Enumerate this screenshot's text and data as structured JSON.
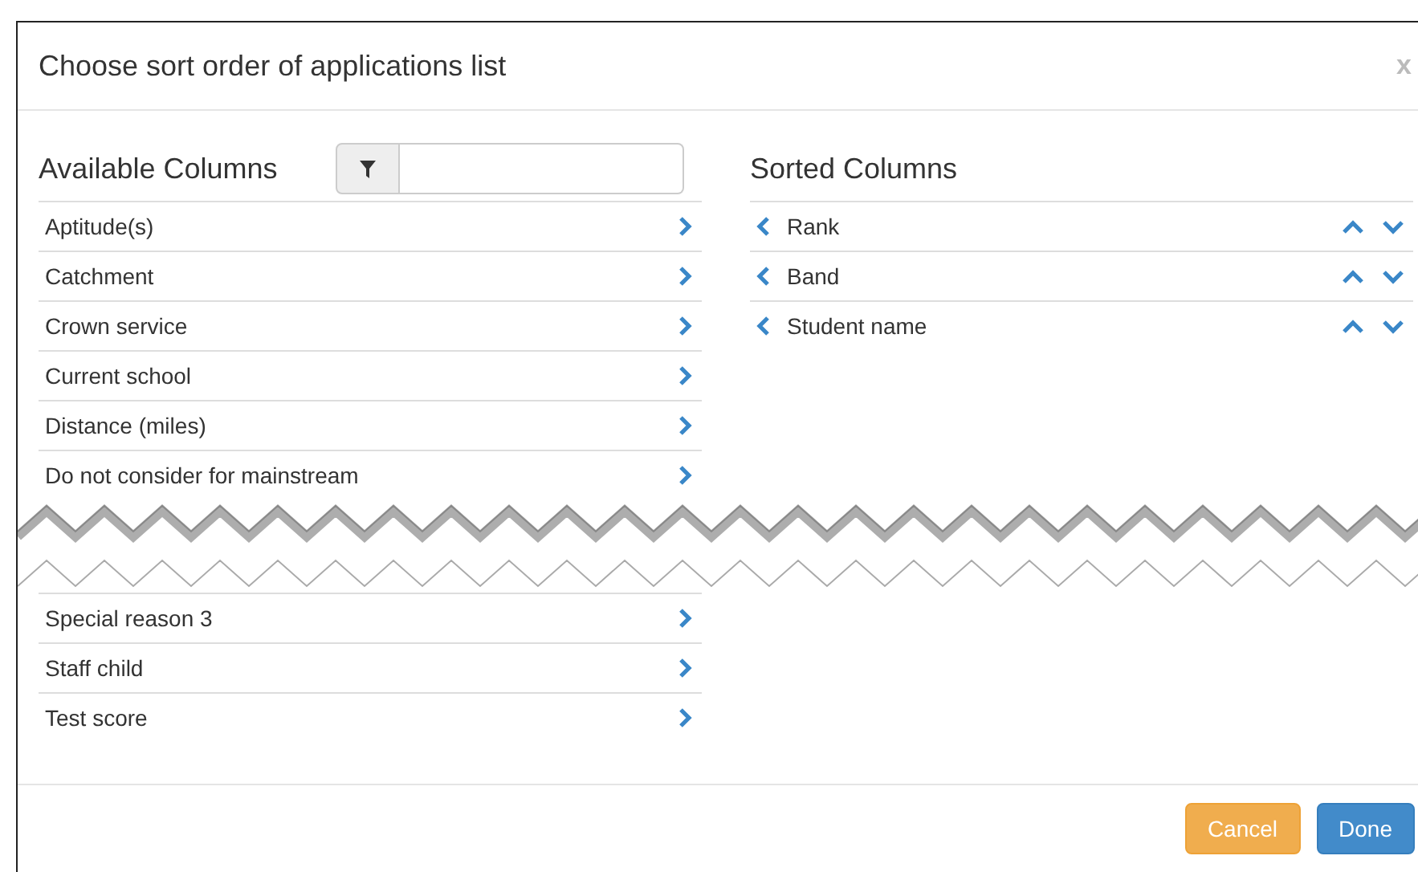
{
  "dialog": {
    "title": "Choose sort order of applications list",
    "close": "x"
  },
  "available": {
    "heading": "Available Columns",
    "rows_before_tear": [
      "Aptitude(s)",
      "Catchment",
      "Crown service",
      "Current school",
      "Distance (miles)",
      "Do not consider for mainstream"
    ],
    "rows_after_tear": [
      "Special reason 3",
      "Staff child",
      "Test score"
    ]
  },
  "sorted": {
    "heading": "Sorted Columns",
    "rows": [
      "Rank",
      "Band",
      "Student name"
    ]
  },
  "buttons": [
    {
      "label": "Cancel",
      "kind": "warning"
    },
    {
      "label": "Done",
      "kind": "primary"
    }
  ]
}
